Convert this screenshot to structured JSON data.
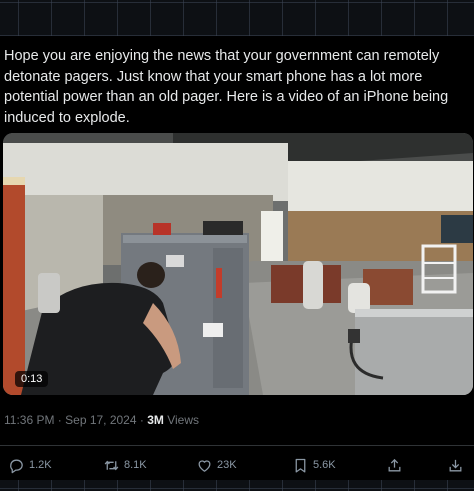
{
  "tweet": {
    "text": "Hope you are enjoying the news that your government can remotely detonate pagers. Just know that your smart phone has a lot more potential power than an old pager. Here is a video of an iPhone being induced to explode.",
    "media": {
      "duration": "0:13"
    },
    "meta": {
      "timestamp": "11:36 PM · Sep 17, 2024 · ",
      "views_count": "3M",
      "views_label": " Views"
    },
    "actions": {
      "replies": "1.2K",
      "reposts": "8.1K",
      "likes": "23K",
      "bookmarks": "5.6K"
    }
  },
  "icons": [
    "reply-icon",
    "repost-icon",
    "like-icon",
    "bookmark-icon",
    "share-icon",
    "download-icon"
  ],
  "colors": {
    "background": "#000000",
    "text": "#e7e9ea",
    "secondary_text": "#71767b",
    "icon": "#8b98a5"
  }
}
